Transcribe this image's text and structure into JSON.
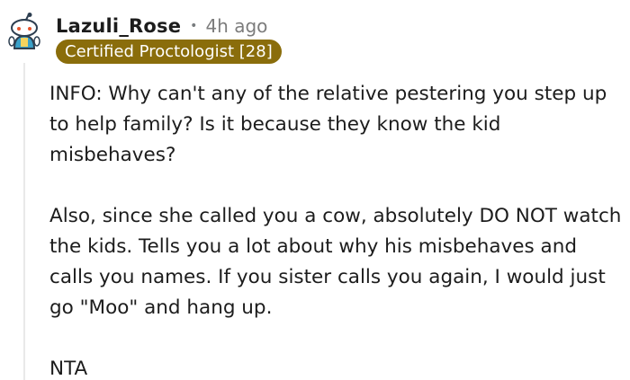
{
  "comment": {
    "author": "Lazuli_Rose",
    "separator": "•",
    "time": "4h ago",
    "flair": "Certified Proctologist [28]",
    "avatar_icon": "snoo-avatar-icon",
    "paragraphs": [
      "INFO: Why can't any of the relative pestering you step up to help family? Is it because they know the kid misbehaves?",
      "Also, since she called you a cow, absolutely DO NOT watch the kids. Tells you a lot about why his misbehaves and calls you names. If you sister calls you again, I would just go \"Moo\" and hang up.",
      "NTA"
    ]
  },
  "colors": {
    "flair_background": "#8a6d0b",
    "thread_line": "#e9e9e9",
    "meta_text": "#7c7c7c"
  }
}
